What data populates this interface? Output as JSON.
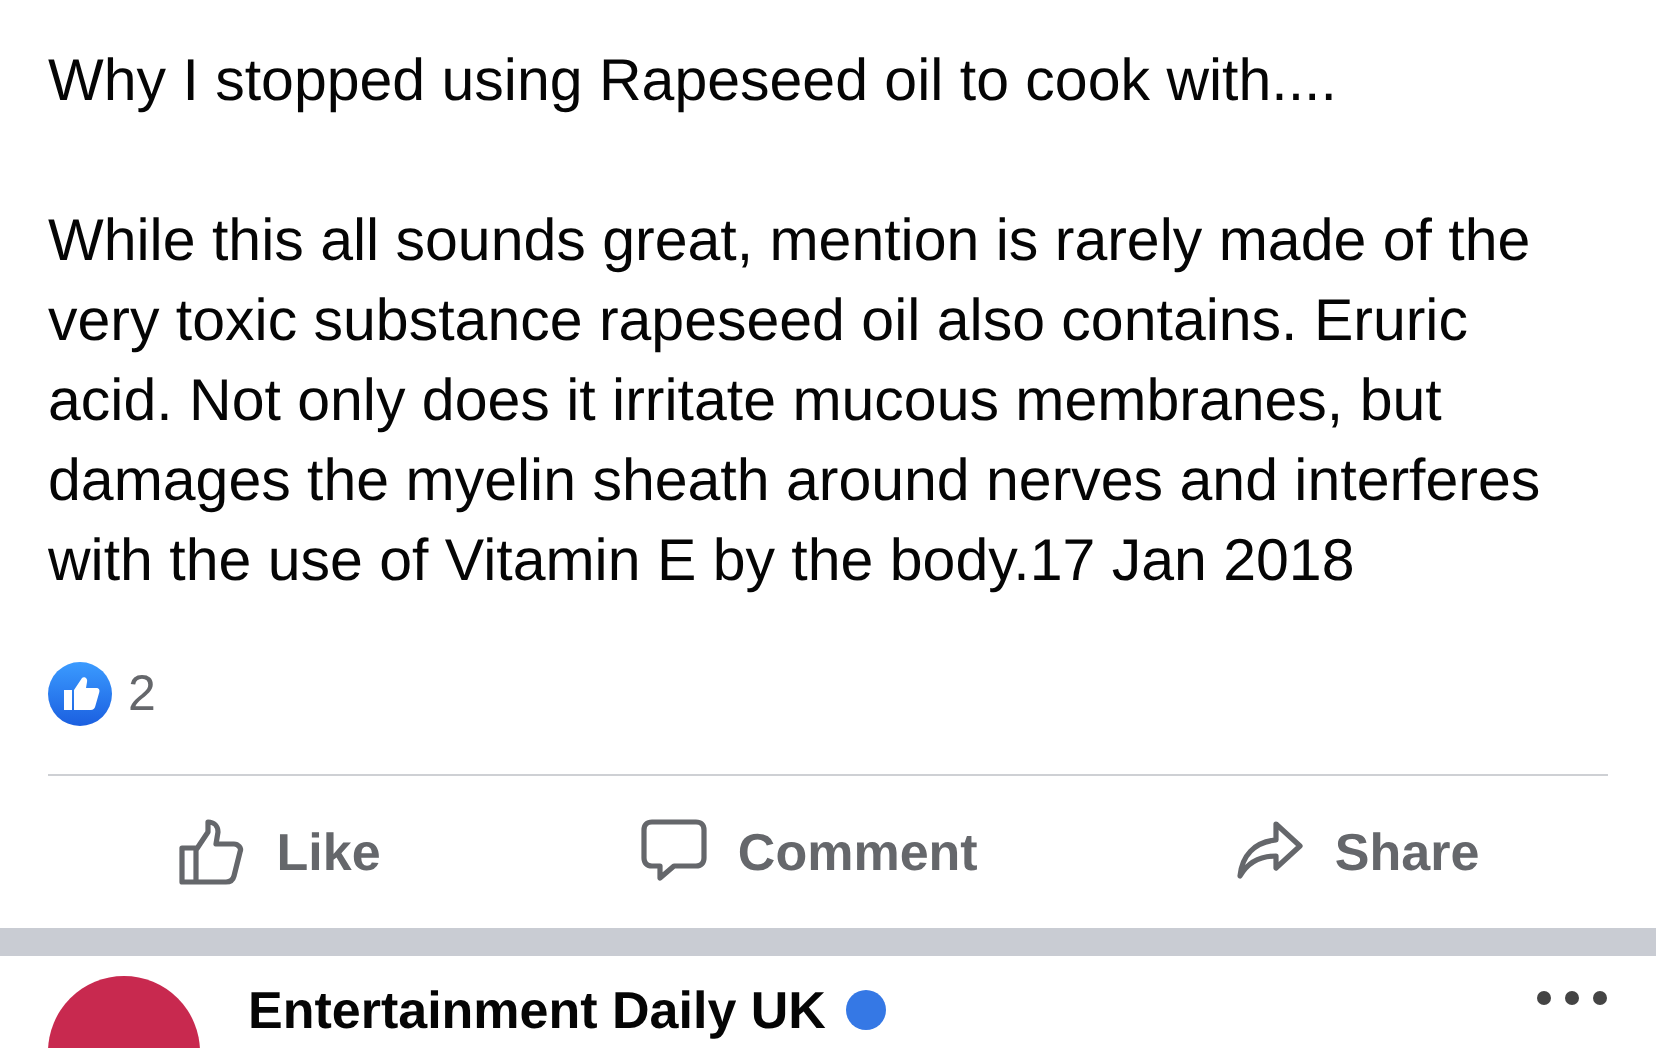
{
  "post": {
    "paragraphs": [
      "Why I stopped using Rapeseed oil to cook with....",
      "While this all sounds great, mention is rarely made of the very toxic substance rapeseed oil also contains. Eruric acid. Not only does it irritate mucous membranes, but damages the myelin sheath around nerves and interferes with the use of Vitamin E by the body.17 Jan 2018"
    ],
    "reactions": {
      "count": "2"
    },
    "actions": [
      {
        "kind": "like",
        "label": "Like"
      },
      {
        "kind": "comment",
        "label": "Comment"
      },
      {
        "kind": "share",
        "label": "Share"
      }
    ]
  },
  "next_post": {
    "page_name": "Entertainment Daily UK",
    "verified": true
  }
}
